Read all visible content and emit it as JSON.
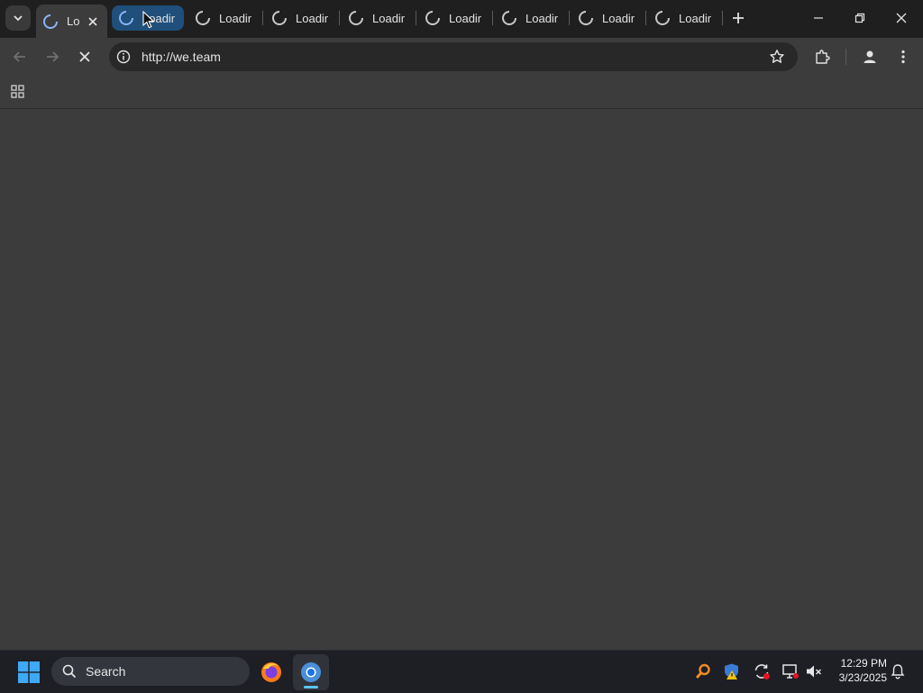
{
  "browser": {
    "tabs": [
      {
        "title": "Lo",
        "state": "active"
      },
      {
        "title": "Loadin",
        "state": "hover"
      },
      {
        "title": "Loading",
        "state": "normal"
      },
      {
        "title": "Loading",
        "state": "normal"
      },
      {
        "title": "Loading",
        "state": "normal"
      },
      {
        "title": "Loading",
        "state": "normal"
      },
      {
        "title": "Loading",
        "state": "normal"
      },
      {
        "title": "Loading",
        "state": "normal"
      },
      {
        "title": "Loading",
        "state": "normal"
      }
    ],
    "address_bar": {
      "url": "http://we.team"
    }
  },
  "taskbar": {
    "search_label": "Search",
    "clock": {
      "time": "12:29 PM",
      "date": "3/23/2025"
    },
    "pinned_apps": [
      "firefox-icon",
      "chrome-icon"
    ]
  },
  "colors": {
    "tabstrip_bg": "#1f1f1f",
    "toolbar_bg": "#3c3c3c",
    "omnibox_bg": "#282828",
    "taskbar_bg": "#1d1f24",
    "hover_tab": "#1f4f7a",
    "accent": "#5cc5f7"
  }
}
